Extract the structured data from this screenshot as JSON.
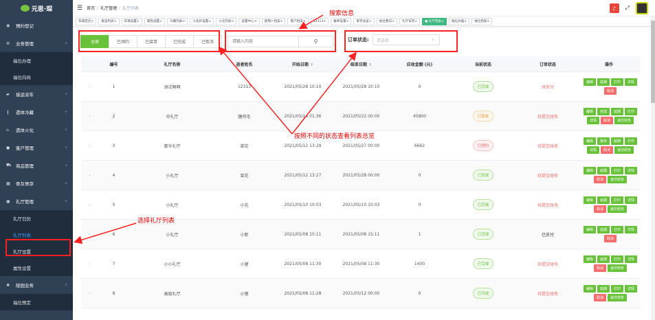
{
  "app": {
    "logo_text": "元思·琛"
  },
  "sidebar": {
    "items": [
      {
        "name": "sidebar-item-reservation",
        "icon": "dashboard-icon",
        "label": "预约登记",
        "sub": false,
        "expanded": false
      },
      {
        "name": "sidebar-item-business",
        "icon": "gear-icon",
        "label": "业务管理",
        "sub": false,
        "expanded": true
      },
      {
        "name": "sidebar-item-slot-handle",
        "label": "福位办理",
        "sub": true
      },
      {
        "name": "sidebar-item-slot-direction",
        "label": "福位向局",
        "sub": true
      },
      {
        "name": "sidebar-item-pickup",
        "icon": "car-icon",
        "label": "接运派车",
        "sub": false,
        "expanded": false
      },
      {
        "name": "sidebar-item-cold",
        "icon": "thermometer-icon",
        "label": "遗体冷藏",
        "sub": false,
        "expanded": false
      },
      {
        "name": "sidebar-item-cremation",
        "icon": "home-icon",
        "label": "遗体火化",
        "sub": false,
        "expanded": false
      },
      {
        "name": "sidebar-item-customer",
        "icon": "user-icon",
        "label": "客户管理",
        "sub": false,
        "expanded": false
      },
      {
        "name": "sidebar-item-goods",
        "icon": "cart-icon",
        "label": "商品管理",
        "sub": false,
        "expanded": false
      },
      {
        "name": "sidebar-item-ashes",
        "icon": "grid-icon",
        "label": "骨灰寄存",
        "sub": false,
        "expanded": false
      },
      {
        "name": "sidebar-item-hall",
        "icon": "calendar-icon",
        "label": "礼厅管理",
        "sub": false,
        "expanded": true
      },
      {
        "name": "sidebar-item-hall-calendar",
        "label": "礼厅日历",
        "sub": true
      },
      {
        "name": "sidebar-item-hall-list",
        "label": "礼厅列表",
        "sub": true,
        "active": true
      },
      {
        "name": "sidebar-item-hall-settings",
        "label": "礼厅设置",
        "sub": true
      },
      {
        "name": "sidebar-item-property",
        "label": "属性设置",
        "sub": true
      },
      {
        "name": "sidebar-item-cemetery",
        "icon": "tree-icon",
        "label": "陵园业务",
        "sub": false,
        "expanded": true
      },
      {
        "name": "sidebar-item-slot-reserve",
        "label": "福位预定",
        "sub": true
      }
    ]
  },
  "navbar": {
    "hamburger": "hamburger-icon",
    "breadcrumb": [
      "首页",
      "礼厅管理",
      "礼厅列表"
    ]
  },
  "tags": [
    {
      "label": "车辆定位",
      "active": false
    },
    {
      "label": "接运列表",
      "active": false
    },
    {
      "label": "车辆设置",
      "active": false
    },
    {
      "label": "属性设置",
      "active": false
    },
    {
      "label": "冷藏列表",
      "active": false
    },
    {
      "label": "火化炉设置",
      "active": false
    },
    {
      "label": "火化列表",
      "active": false
    },
    {
      "label": "设置中心",
      "active": false
    },
    {
      "label": "使用人档案",
      "active": false
    },
    {
      "label": "客户档案",
      "active": false
    },
    {
      "label": "12313",
      "active": false
    },
    {
      "label": "墓碑设置",
      "active": false
    },
    {
      "label": "寄存总览",
      "active": false
    },
    {
      "label": "福位整向",
      "active": false
    },
    {
      "label": "礼厅日历",
      "active": false
    },
    {
      "label": "● 礼厅列表",
      "active": true
    },
    {
      "label": "福位办理",
      "active": false
    },
    {
      "label": "福位档案",
      "active": false
    }
  ],
  "filter": {
    "buttons": [
      "全部",
      "已预约",
      "已接单",
      "已完成",
      "已取消"
    ],
    "active_index": 0
  },
  "search": {
    "placeholder": "请输入内容",
    "button_icon": "search-icon"
  },
  "order_status": {
    "label": "订单状态:",
    "placeholder": "请选择"
  },
  "annotations": {
    "search": "搜索信息",
    "status": "按照不同的状态查看列表总览",
    "hall": "选择礼厅列表"
  },
  "table": {
    "headers": [
      "",
      "编号",
      "礼厅名称",
      "逝者姓名",
      "开始日期",
      "结束日期",
      "应收金额 (元)",
      "当前状态",
      "订单状态",
      "操作"
    ],
    "rows": [
      {
        "no": "1",
        "name": "测试啊啊",
        "deceased": "12313",
        "start": "2021/05/28 10:10",
        "end": "2021/05/28 10:10",
        "amount": "0",
        "status": "已完成",
        "status_type": "done",
        "order": "待支付",
        "order_color": "red",
        "ops": [
          [
            "编辑",
            "g"
          ],
          [
            "延期",
            "g"
          ],
          [
            "打印",
            "g"
          ],
          [
            "详情",
            "g"
          ],
          [
            "取消",
            "r"
          ]
        ]
      },
      {
        "no": "2",
        "name": "中礼厅",
        "deceased": "糖鸡毛",
        "start": "2021/05/14 01:36",
        "end": "2021/05/22 00:00",
        "amount": "45800",
        "status": "已接单",
        "status_type": "pick",
        "order": "待提交财务",
        "order_color": "red",
        "ops": [
          [
            "编辑",
            "g"
          ],
          [
            "完成",
            "g"
          ],
          [
            "延期",
            "g"
          ],
          [
            "打印",
            "g"
          ],
          [
            "详情",
            "g"
          ],
          [
            "取消",
            "r"
          ],
          [
            "递交财务",
            "g"
          ]
        ]
      },
      {
        "no": "3",
        "name": "豪华礼厅",
        "deceased": "菜花",
        "start": "2021/05/12 13:29",
        "end": "2021/05/27 00:00",
        "amount": "6662",
        "status": "已预约",
        "status_type": "book",
        "order": "待提交财务",
        "order_color": "red",
        "ops": [
          [
            "编辑",
            "g"
          ],
          [
            "接单",
            "g"
          ],
          [
            "延期",
            "g"
          ],
          [
            "打印",
            "g"
          ],
          [
            "详情",
            "g"
          ],
          [
            "取消",
            "r"
          ],
          [
            "递交财务",
            "g"
          ]
        ]
      },
      {
        "no": "4",
        "name": "小礼厅",
        "deceased": "菜花",
        "start": "2021/05/12 13:27",
        "end": "2021/05/28 00:00",
        "amount": "0",
        "status": "已完成",
        "status_type": "done",
        "order": "待提交财务",
        "order_color": "red",
        "ops": [
          [
            "编辑",
            "g"
          ],
          [
            "延期",
            "g"
          ],
          [
            "打印",
            "g"
          ],
          [
            "详情",
            "g"
          ],
          [
            "取消",
            "r"
          ],
          [
            "递交财务",
            "g"
          ]
        ]
      },
      {
        "no": "5",
        "name": "小礼厅",
        "deceased": "小花",
        "start": "2021/05/10 10:03",
        "end": "2021/05/10 10:03",
        "amount": "0",
        "status": "已完成",
        "status_type": "done",
        "order": "待提交财务",
        "order_color": "red",
        "ops": [
          [
            "编辑",
            "g"
          ],
          [
            "延期",
            "g"
          ],
          [
            "打印",
            "g"
          ],
          [
            "详情",
            "g"
          ],
          [
            "取消",
            "r"
          ],
          [
            "递交财务",
            "g"
          ]
        ]
      },
      {
        "no": "6",
        "name": "小礼厅",
        "deceased": "小新",
        "start": "2021/05/08 15:11",
        "end": "2021/05/08 15:11",
        "amount": "1",
        "status": "已完成",
        "status_type": "done",
        "order": "已支付",
        "order_color": "blk",
        "ops": [
          [
            "编辑",
            "g"
          ],
          [
            "延期",
            "g"
          ],
          [
            "打印",
            "g"
          ],
          [
            "详情",
            "g"
          ],
          [
            "取消",
            "r"
          ]
        ]
      },
      {
        "no": "7",
        "name": "小小礼厅",
        "deceased": "小猪",
        "start": "2021/05/08 11:30",
        "end": "2021/05/08 11:30",
        "amount": "1400",
        "status": "已完成",
        "status_type": "done",
        "order": "待提交财务",
        "order_color": "red",
        "ops": [
          [
            "编辑",
            "g"
          ],
          [
            "延期",
            "g"
          ],
          [
            "打印",
            "g"
          ],
          [
            "详情",
            "g"
          ],
          [
            "取消",
            "r"
          ],
          [
            "递交财务",
            "g"
          ]
        ]
      },
      {
        "no": "8",
        "name": "高级礼厅",
        "deceased": "小猪",
        "start": "2021/05/08 11:28",
        "end": "2021/05/12 00:00",
        "amount": "0",
        "status": "已完成",
        "status_type": "done",
        "order": "待提交财务",
        "order_color": "red",
        "ops": [
          [
            "编辑",
            "g"
          ],
          [
            "延期",
            "g"
          ],
          [
            "打印",
            "g"
          ],
          [
            "详情",
            "g"
          ],
          [
            "取消",
            "r"
          ],
          [
            "递交财务",
            "g"
          ]
        ]
      }
    ]
  }
}
